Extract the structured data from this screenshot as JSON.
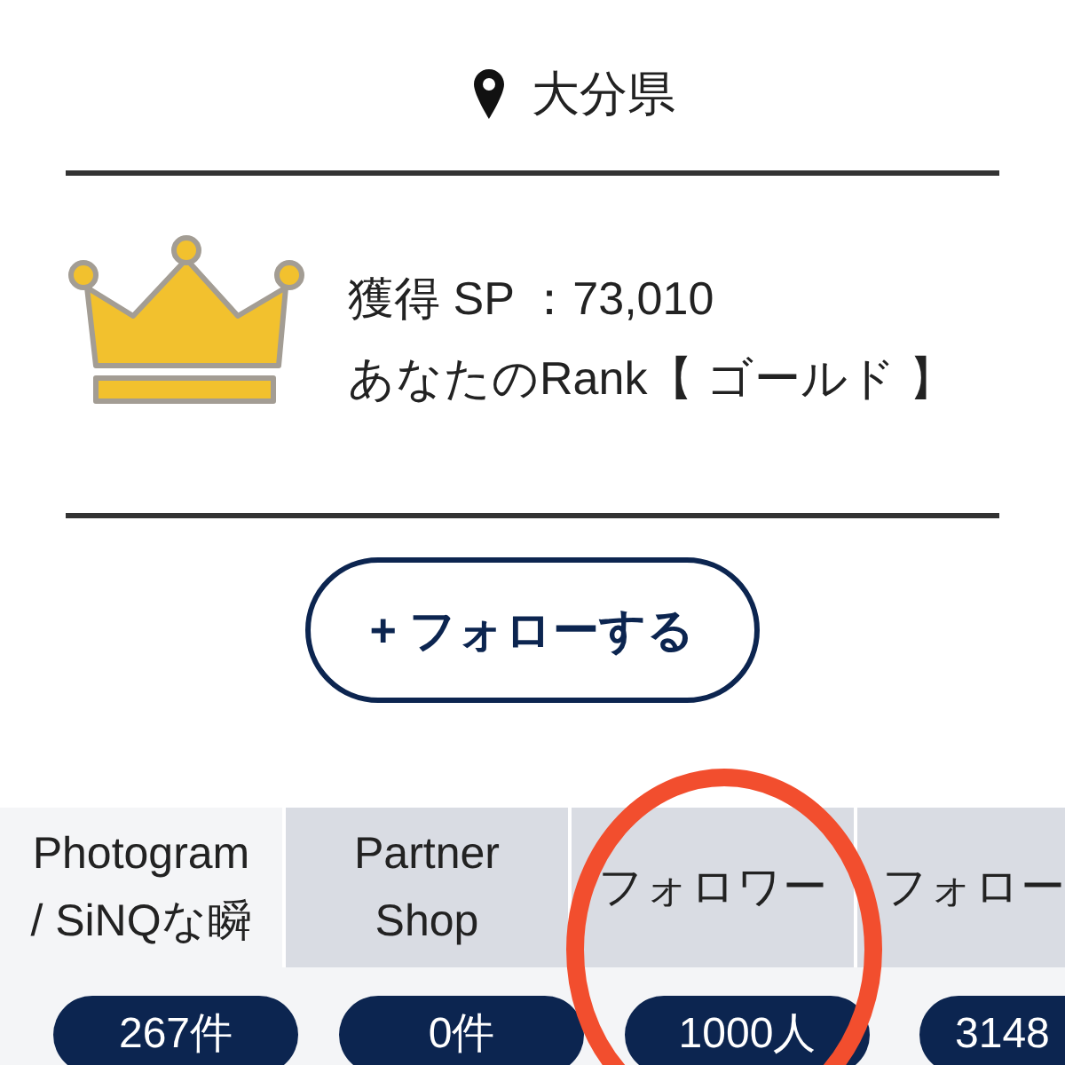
{
  "location": {
    "name": "大分県"
  },
  "rank": {
    "points": "獲得 SP ：73,010",
    "rank": "あなたのRank【 ゴールド 】"
  },
  "follow_button": {
    "label": "+ フォローする"
  },
  "tabs": [
    {
      "label": "Photogram / SiNQな瞬",
      "count": "267件",
      "selected": true,
      "circled": false
    },
    {
      "label": "Partner Shop",
      "count": "0件",
      "selected": false,
      "circled": false
    },
    {
      "label": "フォロワー",
      "count": "1000人",
      "selected": false,
      "circled": true
    },
    {
      "label": "フォロー",
      "count": "3148",
      "selected": false,
      "circled": false
    }
  ]
}
